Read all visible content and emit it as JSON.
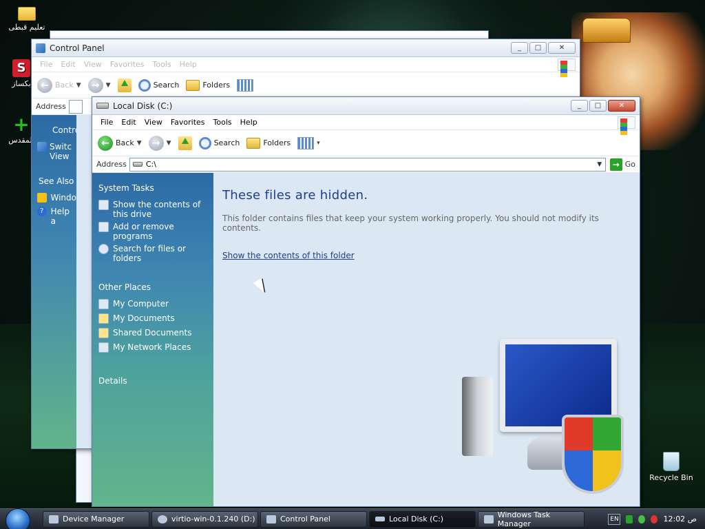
{
  "desktop": {
    "icons": [
      {
        "label": "تعليم قبطى"
      },
      {
        "label": "بكساز"
      },
      {
        "label": "المقدس"
      },
      {
        "label": "Recycle Bin"
      }
    ]
  },
  "back_window": {
    "title": "Control Panel",
    "menu": [
      "File",
      "Edit",
      "View",
      "Favorites",
      "Tools",
      "Help"
    ],
    "toolbar": {
      "back": "Back",
      "search": "Search",
      "folders": "Folders"
    },
    "address_label": "Address",
    "side": {
      "control_title": "Contro",
      "switch_line1": "Switc",
      "switch_line2": "View",
      "see_also": "See Also",
      "windows_update": "Windo",
      "help": "Help a"
    }
  },
  "front_window": {
    "title": "Local Disk (C:)",
    "menu": [
      "File",
      "Edit",
      "View",
      "Favorites",
      "Tools",
      "Help"
    ],
    "toolbar": {
      "back": "Back",
      "search": "Search",
      "folders": "Folders"
    },
    "address_label": "Address",
    "address_value": "C:\\",
    "go_label": "Go",
    "system_tasks": {
      "title": "System Tasks",
      "items": [
        {
          "line1": "Show the contents of",
          "line2": "this drive"
        },
        {
          "line1": "Add or remove",
          "line2": "programs"
        },
        {
          "line1": "Search for files or",
          "line2": "folders"
        }
      ]
    },
    "other_places": {
      "title": "Other Places",
      "items": [
        "My Computer",
        "My Documents",
        "Shared Documents",
        "My Network Places"
      ]
    },
    "details_title": "Details",
    "main": {
      "heading": "These files are hidden.",
      "message": "This folder contains files that keep your system working properly. You should not modify its contents.",
      "link": "Show the contents of this folder"
    }
  },
  "taskbar": {
    "tasks": [
      {
        "label": "Device Manager",
        "active": false
      },
      {
        "label": "virtio-win-0.1.240 (D:)",
        "active": false
      },
      {
        "label": "Control Panel",
        "active": false
      },
      {
        "label": "Local Disk (C:)",
        "active": true
      },
      {
        "label": "Windows Task Manager",
        "active": false
      }
    ],
    "lang": "EN",
    "clock": "12:02 ص"
  }
}
